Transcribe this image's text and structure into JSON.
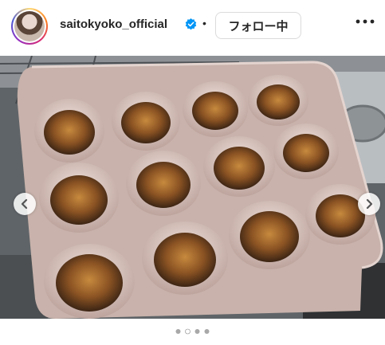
{
  "post": {
    "username": "saitokyoko_official",
    "separator": "•",
    "follow_label": "フォロー中"
  },
  "carousel": {
    "slide_count": 4,
    "active_index": 1
  },
  "colors": {
    "text": "#262626",
    "verified": "#0095f6",
    "active_dot": "#ffffff",
    "inactive_dot": "#a8a8a8"
  },
  "icons": {
    "verified": "verified-badge-icon",
    "more": "more-options-icon",
    "prev": "chevron-left-icon",
    "next": "chevron-right-icon"
  }
}
